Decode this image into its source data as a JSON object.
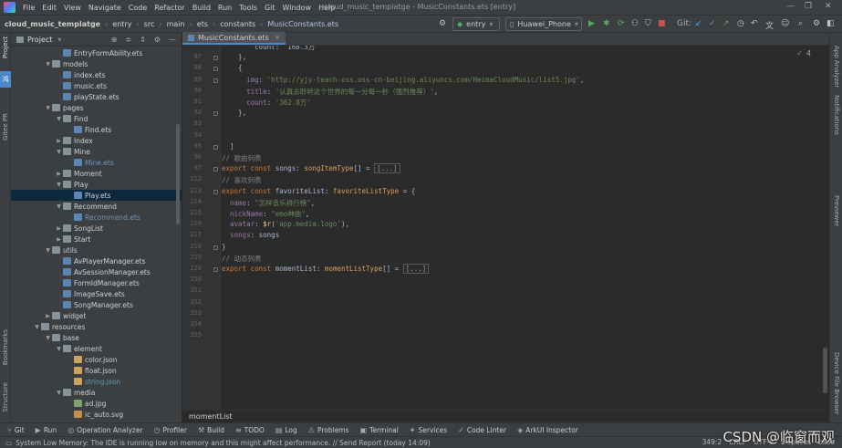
{
  "menubar": {
    "items": [
      "File",
      "Edit",
      "View",
      "Navigate",
      "Code",
      "Refactor",
      "Build",
      "Run",
      "Tools",
      "Git",
      "Window",
      "Help"
    ],
    "window_title": "cloud_music_templatge - MusicConstants.ets [entry]"
  },
  "navbar": {
    "crumbs": [
      "cloud_music_templatge",
      "entry",
      "src",
      "main",
      "ets",
      "constants",
      "MusicConstants.ets"
    ],
    "module_select": "entry",
    "device_select": "Huawei_Phone",
    "git_label": "Git:"
  },
  "project": {
    "title": "Project",
    "rows": [
      {
        "indent": 5,
        "arrow": "",
        "icon": "file-ets",
        "label": "EntryFormAbility.ets"
      },
      {
        "indent": 4,
        "arrow": "v",
        "icon": "folder",
        "label": "models"
      },
      {
        "indent": 5,
        "arrow": "",
        "icon": "file-ets",
        "label": "index.ets"
      },
      {
        "indent": 5,
        "arrow": "",
        "icon": "file-ets",
        "label": "music.ets"
      },
      {
        "indent": 5,
        "arrow": "",
        "icon": "file-ets",
        "label": "playState.ets"
      },
      {
        "indent": 4,
        "arrow": "v",
        "icon": "folder",
        "label": "pages"
      },
      {
        "indent": 5,
        "arrow": "v",
        "icon": "folder",
        "label": "Find"
      },
      {
        "indent": 6,
        "arrow": "",
        "icon": "file-ets",
        "label": "Find.ets"
      },
      {
        "indent": 5,
        "arrow": ">",
        "icon": "folder",
        "label": "Index"
      },
      {
        "indent": 5,
        "arrow": "v",
        "icon": "folder",
        "label": "Mine"
      },
      {
        "indent": 6,
        "arrow": "",
        "icon": "file-ets",
        "label": "Mine.ets",
        "mod": true
      },
      {
        "indent": 5,
        "arrow": ">",
        "icon": "folder",
        "label": "Moment"
      },
      {
        "indent": 5,
        "arrow": "v",
        "icon": "folder",
        "label": "Play"
      },
      {
        "indent": 6,
        "arrow": "",
        "icon": "file-ets",
        "label": "Play.ets",
        "sel": true
      },
      {
        "indent": 5,
        "arrow": "v",
        "icon": "folder",
        "label": "Recommend"
      },
      {
        "indent": 6,
        "arrow": "",
        "icon": "file-ets",
        "label": "Recommend.ets",
        "mod": true
      },
      {
        "indent": 5,
        "arrow": ">",
        "icon": "folder",
        "label": "SongList"
      },
      {
        "indent": 5,
        "arrow": ">",
        "icon": "folder",
        "label": "Start"
      },
      {
        "indent": 4,
        "arrow": "v",
        "icon": "folder",
        "label": "utils"
      },
      {
        "indent": 5,
        "arrow": "",
        "icon": "file-ets",
        "label": "AvPlayerManager.ets"
      },
      {
        "indent": 5,
        "arrow": "",
        "icon": "file-ets",
        "label": "AvSessionManager.ets"
      },
      {
        "indent": 5,
        "arrow": "",
        "icon": "file-ets",
        "label": "FormIdManager.ets"
      },
      {
        "indent": 5,
        "arrow": "",
        "icon": "file-ets",
        "label": "ImageSave.ets"
      },
      {
        "indent": 5,
        "arrow": "",
        "icon": "file-ets",
        "label": "SongManager.ets"
      },
      {
        "indent": 4,
        "arrow": ">",
        "icon": "folder",
        "label": "widget"
      },
      {
        "indent": 3,
        "arrow": "v",
        "icon": "folder",
        "label": "resources"
      },
      {
        "indent": 4,
        "arrow": "v",
        "icon": "folder",
        "label": "base"
      },
      {
        "indent": 5,
        "arrow": "v",
        "icon": "folder",
        "label": "element"
      },
      {
        "indent": 6,
        "arrow": "",
        "icon": "file-json",
        "label": "color.json"
      },
      {
        "indent": 6,
        "arrow": "",
        "icon": "file-json",
        "label": "float.json"
      },
      {
        "indent": 6,
        "arrow": "",
        "icon": "file-json",
        "label": "string.json",
        "mod": true
      },
      {
        "indent": 5,
        "arrow": "v",
        "icon": "folder",
        "label": "media"
      },
      {
        "indent": 6,
        "arrow": "",
        "icon": "file-img",
        "label": "ad.jpg"
      },
      {
        "indent": 6,
        "arrow": "",
        "icon": "file-svg",
        "label": "ic_auto.svg"
      }
    ]
  },
  "editor": {
    "tab": "MusicConstants.ets",
    "inspection_count": "4",
    "bottom_breadcrumb": "momentList",
    "lines": [
      {
        "n": "",
        "html": "        count: '168.3万'"
      },
      {
        "n": "87",
        "html": "    },"
      },
      {
        "n": "88",
        "html": "    {"
      },
      {
        "n": "89",
        "html": "      <span class=\"prop\">img</span>: <span class=\"str\">'http://yjy-teach-oss.oss-cn-beijing.aliyuncs.com/HeimaCloudMusic/list5.jpg'</span>,"
      },
      {
        "n": "90",
        "html": "      <span class=\"prop\">title</span>: <span class=\"str\">'认真去聆听这个世界的每一分每一秒（强烈推荐）'</span>,"
      },
      {
        "n": "91",
        "html": "      <span class=\"prop\">count</span>: <span class=\"str\">'362.8万'</span>"
      },
      {
        "n": "92",
        "html": "    },"
      },
      {
        "n": "93",
        "html": ""
      },
      {
        "n": "94",
        "html": ""
      },
      {
        "n": "95",
        "html": "  ]"
      },
      {
        "n": "96",
        "html": "<span class=\"cmt\">// 歌曲列表</span>"
      },
      {
        "n": "97",
        "html": "<span class=\"kw\">export const</span> songs: <span class=\"typ\">songItemType</span>[] = <span class=\"fold-box\">[...]</span>"
      },
      {
        "n": "212",
        "html": "<span class=\"cmt\">// 喜欢列表</span>"
      },
      {
        "n": "213",
        "html": "<span class=\"kw\">export const</span> favoriteList: <span class=\"typ\">favoriteListType</span> = {"
      },
      {
        "n": "214",
        "html": "  <span class=\"prop\">name</span>: <span class=\"str\">\"怎样音乐排行榜\"</span>,"
      },
      {
        "n": "215",
        "html": "  <span class=\"prop\">nickName</span>: <span class=\"str\">\"emo神曲\"</span>,"
      },
      {
        "n": "216",
        "html": "  <span class=\"prop\">avatar</span>: <span class=\"fn\">$r</span>(<span class=\"str\">'app.media.logo'</span>),"
      },
      {
        "n": "217",
        "html": "  <span class=\"prop\">songs</span>: songs"
      },
      {
        "n": "218",
        "html": "}"
      },
      {
        "n": "219",
        "html": "<span class=\"cmt\">// 动态列表</span>"
      },
      {
        "n": "220",
        "html": "<span class=\"kw\">export const</span> momentList: <span class=\"typ\">momentListType</span>[] = <span class=\"fold-box\">[...]</span>"
      },
      {
        "n": "350",
        "html": ""
      },
      {
        "n": "351",
        "html": ""
      },
      {
        "n": "352",
        "html": ""
      },
      {
        "n": "353",
        "html": ""
      },
      {
        "n": "354",
        "html": ""
      },
      {
        "n": "355",
        "html": ""
      }
    ]
  },
  "left_strip": [
    "Project",
    "Gitee PR",
    "Bookmarks",
    "Structure"
  ],
  "right_strip": [
    "App Analyzer",
    "Notifications",
    "Previewer",
    "Device File Browser"
  ],
  "toolbar": {
    "items": [
      {
        "icon": "⑂",
        "label": "Git"
      },
      {
        "icon": "▶",
        "label": "Run"
      },
      {
        "icon": "◎",
        "label": "Operation Analyzer"
      },
      {
        "icon": "◷",
        "label": "Profiler"
      },
      {
        "icon": "⚒",
        "label": "Build"
      },
      {
        "icon": "≡",
        "label": "TODO"
      },
      {
        "icon": "▤",
        "label": "Log"
      },
      {
        "icon": "⚠",
        "label": "Problems"
      },
      {
        "icon": "▣",
        "label": "Terminal"
      },
      {
        "icon": "✦",
        "label": "Services"
      },
      {
        "icon": "✓",
        "label": "Code Linter"
      },
      {
        "icon": "◈",
        "label": "ArkUI Inspector"
      }
    ]
  },
  "status": {
    "message": "System Low Memory: The IDE is running low on memory and this might affect performance. // Send Report (today 14:09)",
    "position": "349:2",
    "line_ending": "CRLF",
    "encoding": "UTF-8",
    "indent": "2 spaces",
    "branch": "base"
  },
  "watermark": "CSDN @临窗而观"
}
